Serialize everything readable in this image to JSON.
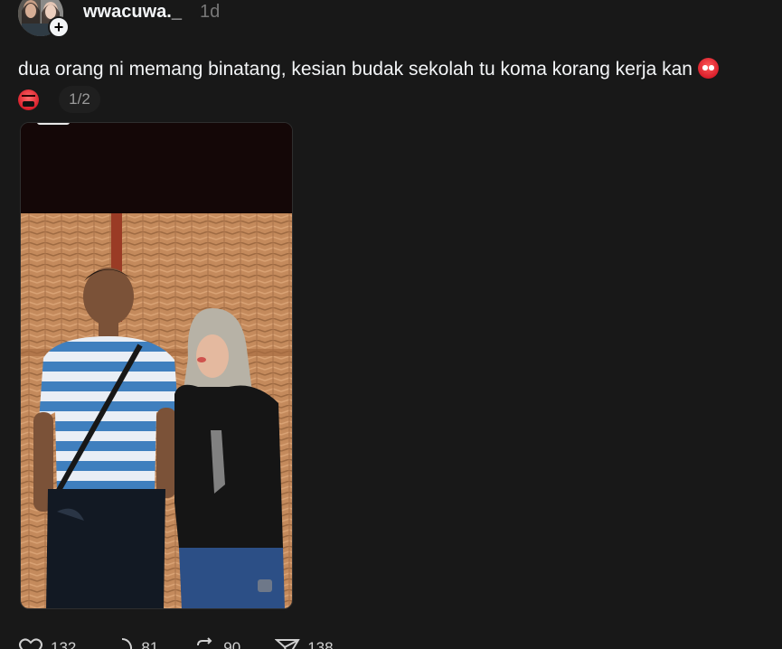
{
  "header": {
    "username": "wwacuwa._",
    "timestamp": "1d",
    "follow_symbol": "+"
  },
  "post": {
    "caption": "dua orang ni memang binatang, kesian budak sekolah tu koma korang kerja kan",
    "emojis": [
      "angry-face",
      "cursing-face"
    ],
    "media_counter": "1/2"
  },
  "actions": {
    "likes": "132",
    "replies": "81",
    "reposts": "90",
    "shares": "138"
  },
  "colors": {
    "background": "#181818",
    "text": "#f3f5f7",
    "muted": "#777777"
  }
}
